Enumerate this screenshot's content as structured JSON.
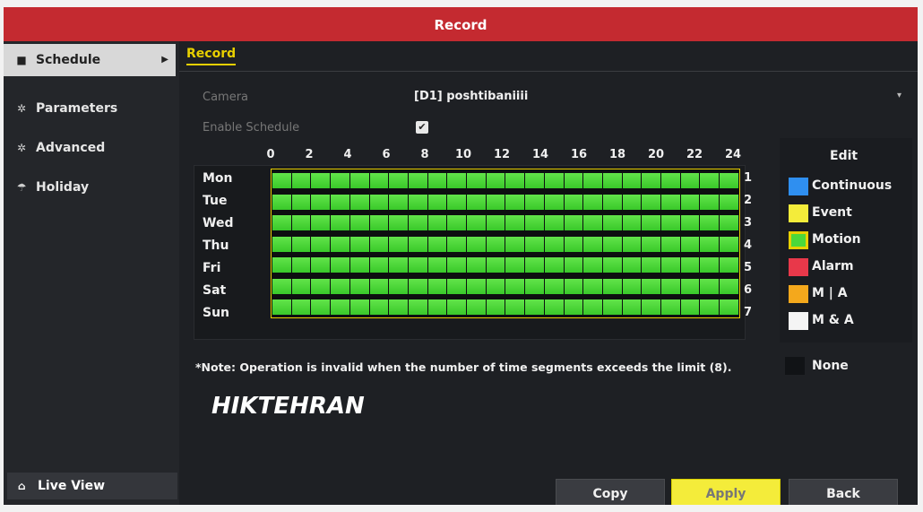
{
  "window": {
    "title": "Record"
  },
  "sidebar": {
    "items": [
      {
        "label": "Schedule",
        "icon": "schedule-icon",
        "active": true
      },
      {
        "label": "Parameters",
        "icon": "parameters-icon",
        "active": false
      },
      {
        "label": "Advanced",
        "icon": "advanced-icon",
        "active": false
      },
      {
        "label": "Holiday",
        "icon": "holiday-icon",
        "active": false
      }
    ],
    "live_view": "Live View"
  },
  "main": {
    "tab": "Record",
    "camera_label": "Camera",
    "camera_value": "[D1] poshtibaniiii",
    "enable_label": "Enable Schedule",
    "enable_checked": true
  },
  "schedule": {
    "hours": [
      "0",
      "2",
      "4",
      "6",
      "8",
      "10",
      "12",
      "14",
      "16",
      "18",
      "20",
      "22",
      "24"
    ],
    "days": [
      "Mon",
      "Tue",
      "Wed",
      "Thu",
      "Fri",
      "Sat",
      "Sun"
    ],
    "day_numbers": [
      "1",
      "2",
      "3",
      "4",
      "5",
      "6",
      "7"
    ],
    "cells_per_row": 24,
    "fill_type": "Motion",
    "fill_color": "#4cd83a"
  },
  "legend": {
    "edit_label": "Edit",
    "items": [
      {
        "label": "Continuous",
        "color": "#2f8ff0"
      },
      {
        "label": "Event",
        "color": "#f4ec3a"
      },
      {
        "label": "Motion",
        "color": "#4cd83a",
        "border": "#e8d000"
      },
      {
        "label": "Alarm",
        "color": "#e8384a"
      },
      {
        "label": "M | A",
        "color": "#f4a81c"
      },
      {
        "label": "M & A",
        "color": "#f4f4f4"
      }
    ],
    "none_label": "None"
  },
  "note": "*Note: Operation is invalid when the number of time segments exceeds the limit (8).",
  "watermark": "HIKTEHRAN",
  "buttons": {
    "copy": "Copy",
    "apply": "Apply",
    "back": "Back"
  },
  "colors": {
    "titlebar": "#c42a30",
    "accent": "#e8d000"
  }
}
